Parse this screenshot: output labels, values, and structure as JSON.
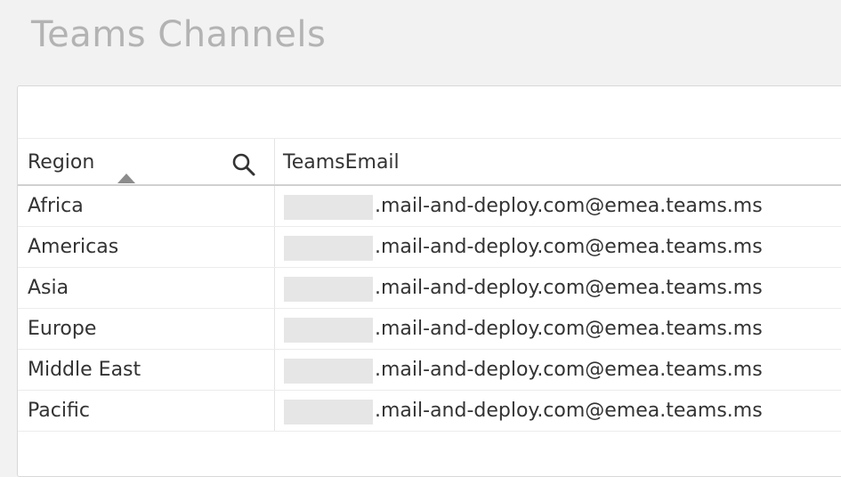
{
  "page": {
    "title": "Teams Channels"
  },
  "table": {
    "columns": [
      {
        "label": "Region"
      },
      {
        "label": "TeamsEmail"
      }
    ],
    "rows": [
      {
        "region": "Africa",
        "email_suffix": ".mail-and-deploy.com@emea.teams.ms"
      },
      {
        "region": "Americas",
        "email_suffix": ".mail-and-deploy.com@emea.teams.ms"
      },
      {
        "region": "Asia",
        "email_suffix": ".mail-and-deploy.com@emea.teams.ms"
      },
      {
        "region": "Europe",
        "email_suffix": ".mail-and-deploy.com@emea.teams.ms"
      },
      {
        "region": "Middle East",
        "email_suffix": ".mail-and-deploy.com@emea.teams.ms"
      },
      {
        "region": "Pacific",
        "email_suffix": ".mail-and-deploy.com@emea.teams.ms"
      }
    ]
  },
  "icons": {
    "search": "search-icon",
    "sort": "sort-ascending-icon"
  },
  "colors": {
    "background": "#f2f2f2",
    "title": "#b3b3b3",
    "text": "#333333",
    "redacted": "#e6e6e6"
  }
}
